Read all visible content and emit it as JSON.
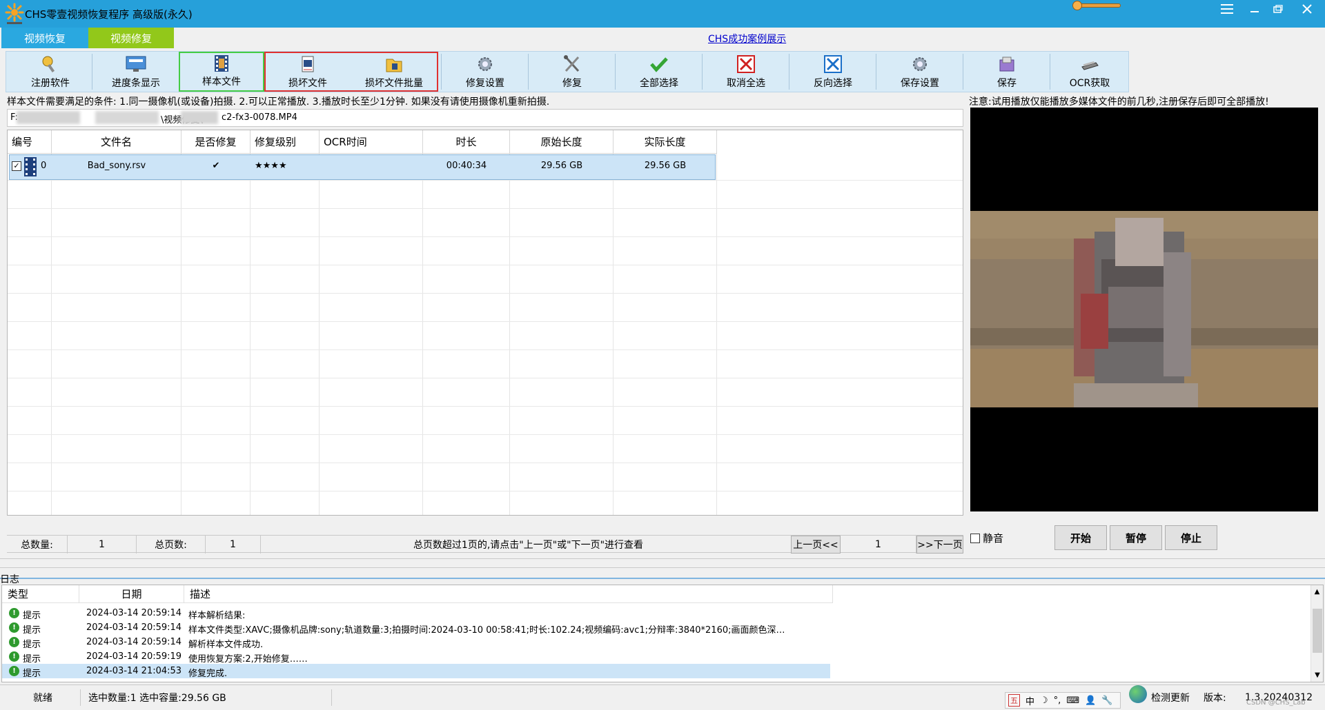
{
  "window": {
    "title": "CHS零壹视频恢复程序 高级版(永久)",
    "controls": [
      "menu-icon",
      "minimize-icon",
      "restore-icon",
      "close-icon"
    ]
  },
  "mode_tabs": [
    {
      "label": "视频恢复",
      "color": "#2aa8e0"
    },
    {
      "label": "视频修复",
      "color": "#92c81a"
    }
  ],
  "case_link": "CHS成功案例展示",
  "toolbar": [
    {
      "label": "注册软件",
      "icon": "key-icon"
    },
    {
      "label": "进度条显示",
      "icon": "monitor-icon"
    },
    {
      "label": "样本文件",
      "icon": "film-icon"
    },
    {
      "label": "损坏文件",
      "icon": "damaged-file-icon"
    },
    {
      "label": "损坏文件批量",
      "icon": "folder-icon"
    },
    {
      "label": "修复设置",
      "icon": "gear-icon"
    },
    {
      "label": "修复",
      "icon": "tools-icon"
    },
    {
      "label": "全部选择",
      "icon": "check-icon"
    },
    {
      "label": "取消全选",
      "icon": "red-x-icon"
    },
    {
      "label": "反向选择",
      "icon": "blue-x-icon"
    },
    {
      "label": "保存设置",
      "icon": "save-gear-icon"
    },
    {
      "label": "保存",
      "icon": "disk-icon"
    },
    {
      "label": "OCR获取",
      "icon": "scanner-icon"
    }
  ],
  "hint": "样本文件需要满足的条件: 1.同一摄像机(或设备)拍摄.  2.可以正常播放.  3.播放时长至少1分钟.  如果没有请使用摄像机重新拍摄.",
  "path": {
    "prefix": "F:",
    "mid": "\\视频修复\\",
    "suffix": "c2-fx3-0078.MP4"
  },
  "table": {
    "columns": [
      "编号",
      "文件名",
      "是否修复",
      "修复级别",
      "OCR时间",
      "时长",
      "原始长度",
      "实际长度"
    ],
    "rows": [
      {
        "id": "0",
        "file": "Bad_sony.rsv",
        "repaired": "✔",
        "level": "★★★★",
        "ocr": "",
        "duration": "00:40:34",
        "orig_size": "29.56 GB",
        "actual_size": "29.56 GB"
      }
    ]
  },
  "pager": {
    "total_label": "总数量:",
    "total": "1",
    "pages_label": "总页数:",
    "pages": "1",
    "note": "总页数超过1页的,请点击\"上一页\"或\"下一页\"进行查看",
    "prev": "上一页<<",
    "page": "1",
    "next": ">>下一页"
  },
  "preview": {
    "note": "注意:试用播放仅能播放多媒体文件的前几秒,注册保存后即可全部播放!",
    "mute": "静音",
    "start": "开始",
    "pause": "暂停",
    "stop": "停止"
  },
  "log": {
    "label": "日志",
    "columns": [
      "类型",
      "日期",
      "描述"
    ],
    "rows": [
      {
        "type": "提示",
        "date": "2024-03-14 20:59:14",
        "desc": "样本解析结果:"
      },
      {
        "type": "提示",
        "date": "2024-03-14 20:59:14",
        "desc": "样本文件类型:XAVC;摄像机品牌:sony;轨道数量:3;拍摄时间:2024-03-10 00:58:41;时长:102.24;视频编码:avc1;分辩率:3840*2160;画面颜色深…"
      },
      {
        "type": "提示",
        "date": "2024-03-14 20:59:14",
        "desc": "解析样本文件成功."
      },
      {
        "type": "提示",
        "date": "2024-03-14 20:59:19",
        "desc": "使用恢复方案:2,开始修复……"
      },
      {
        "type": "提示",
        "date": "2024-03-14 21:04:53",
        "desc": "修复完成."
      }
    ]
  },
  "status": {
    "ready": "就绪",
    "selection": "选中数量:1 选中容量:29.56 GB",
    "tray": [
      "五",
      "中",
      "☽",
      "°,",
      "⌨",
      "👤",
      "🔧"
    ],
    "update": "检测更新",
    "version_label": "版本:",
    "version": "1.3.20240312",
    "watermark": "CSDN @CHS_Lab"
  }
}
